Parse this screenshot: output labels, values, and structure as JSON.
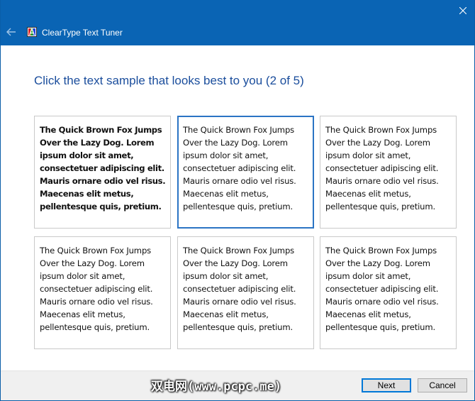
{
  "window": {
    "title": "ClearType Text Tuner",
    "titlebar_color": "#0a64b4",
    "close_icon": "close-icon",
    "back_icon": "back-arrow-icon"
  },
  "page": {
    "heading": "Click the text sample that looks best to you (2 of 5)",
    "heading_color": "#1a4d9c"
  },
  "samples": [
    {
      "text": "The Quick Brown Fox Jumps\nOver the Lazy Dog. Lorem\nipsum dolor sit amet,\nconsectetuer adipiscing elit.\nMauris ornare odio vel risus.\nMaecenas elit metus,\npellentesque quis, pretium.",
      "selected": false
    },
    {
      "text": "The Quick Brown Fox Jumps\nOver the Lazy Dog. Lorem\nipsum dolor sit amet,\nconsectetuer adipiscing elit.\nMauris ornare odio vel risus.\nMaecenas elit metus,\npellentesque quis, pretium.",
      "selected": true
    },
    {
      "text": "The Quick Brown Fox Jumps\nOver the Lazy Dog. Lorem\nipsum dolor sit amet,\nconsectetuer adipiscing elit.\nMauris ornare odio vel risus.\nMaecenas elit metus,\npellentesque quis, pretium.",
      "selected": false
    },
    {
      "text": "The Quick Brown Fox Jumps\nOver the Lazy Dog. Lorem\nipsum dolor sit amet,\nconsectetuer adipiscing elit.\nMauris ornare odio vel risus.\nMaecenas elit metus,\npellentesque quis, pretium.",
      "selected": false
    },
    {
      "text": "The Quick Brown Fox Jumps\nOver the Lazy Dog. Lorem\nipsum dolor sit amet,\nconsectetuer adipiscing elit.\nMauris ornare odio vel risus.\nMaecenas elit metus,\npellentesque quis, pretium.",
      "selected": false
    },
    {
      "text": "The Quick Brown Fox Jumps\nOver the Lazy Dog. Lorem\nipsum dolor sit amet,\nconsectetuer adipiscing elit.\nMauris ornare odio vel risus.\nMaecenas elit metus,\npellentesque quis, pretium.",
      "selected": false
    }
  ],
  "footer": {
    "watermark": "双电网(www.pcpc.me)",
    "next_label": "Next",
    "cancel_label": "Cancel"
  }
}
